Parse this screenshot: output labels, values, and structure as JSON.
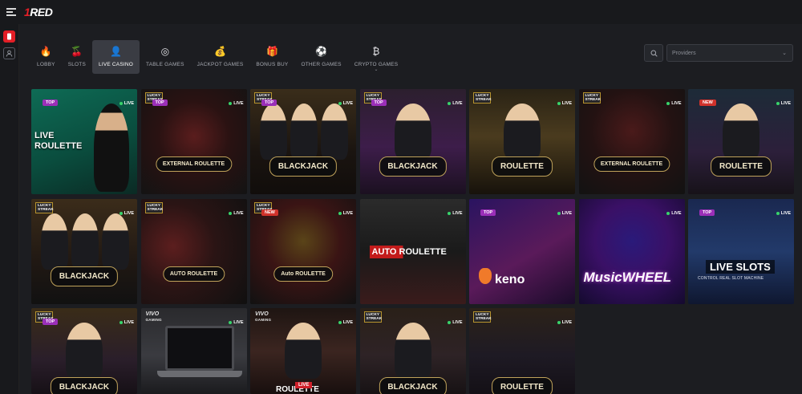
{
  "brand": {
    "logo_num": "1",
    "logo_word": "RED"
  },
  "nav": [
    {
      "label": "LOBBY",
      "icon": "flame-icon",
      "glyph": "🔥",
      "active": false
    },
    {
      "label": "SLOTS",
      "icon": "cherries-icon",
      "glyph": "🍒",
      "active": false
    },
    {
      "label": "LIVE CASINO",
      "icon": "dealer-icon",
      "glyph": "👤",
      "active": true
    },
    {
      "label": "TABLE GAMES",
      "icon": "chips-icon",
      "glyph": "◎",
      "active": false
    },
    {
      "label": "JACKPOT GAMES",
      "icon": "money-bag-icon",
      "glyph": "💰",
      "active": false
    },
    {
      "label": "BONUS BUY",
      "icon": "gift-icon",
      "glyph": "🎁",
      "active": false
    },
    {
      "label": "OTHER GAMES",
      "icon": "soccer-ball-icon",
      "glyph": "⚽",
      "active": false
    },
    {
      "label": "CRYPTO GAMES",
      "icon": "crypto-coins-icon",
      "glyph": "₿",
      "active": false
    }
  ],
  "providers": {
    "placeholder": "Providers"
  },
  "badges": {
    "top": "TOP",
    "new": "NEW",
    "live": "LIVE",
    "lucky_line1": "LUCKY",
    "lucky_line2": "STREAK",
    "vivo": "VIVO",
    "vivo_sub": "GAMING"
  },
  "tiles": [
    {
      "title": "LIVE ROULETTE",
      "badge": "TOP",
      "lucky": false,
      "vivo": false
    },
    {
      "title": "EXTERNAL ROULETTE",
      "badge": "TOP",
      "lucky": true,
      "vivo": false
    },
    {
      "title": "BLACKJACK",
      "badge": "TOP",
      "lucky": true,
      "vivo": false
    },
    {
      "title": "BLACKJACK",
      "badge": "TOP",
      "lucky": true,
      "vivo": false
    },
    {
      "title": "ROULETTE",
      "badge": "",
      "lucky": true,
      "vivo": false
    },
    {
      "title": "EXTERNAL ROULETTE",
      "badge": "",
      "lucky": true,
      "vivo": false
    },
    {
      "title": "ROULETTE",
      "badge": "NEW",
      "lucky": false,
      "vivo": false
    },
    {
      "title": "BLACKJACK",
      "badge": "",
      "lucky": true,
      "vivo": false
    },
    {
      "title": "AUTO ROULETTE",
      "badge": "",
      "lucky": true,
      "vivo": false
    },
    {
      "title": "Auto ROULETTE",
      "badge": "NEW",
      "lucky": true,
      "vivo": false
    },
    {
      "title": "AUTO ROULETTE",
      "badge": "",
      "lucky": false,
      "vivo": false
    },
    {
      "title": "keno",
      "badge": "TOP",
      "lucky": false,
      "vivo": false
    },
    {
      "title": "MusicWHEEL",
      "badge": "",
      "lucky": false,
      "vivo": false
    },
    {
      "title": "LIVE SLOTS",
      "subtitle": "CONTROL REAL SLOT MACHINE",
      "badge": "TOP",
      "lucky": false,
      "vivo": false
    },
    {
      "title": "BLACKJACK",
      "badge": "TOP",
      "lucky": true,
      "vivo": false
    },
    {
      "title": "",
      "badge": "",
      "lucky": false,
      "vivo": true
    },
    {
      "title": "ROULETTE",
      "badge": "",
      "lucky": false,
      "vivo": true,
      "live_tag": "LIVE"
    },
    {
      "title": "BLACKJACK",
      "badge": "",
      "lucky": true,
      "vivo": false
    },
    {
      "title": "ROULETTE",
      "badge": "",
      "lucky": true,
      "vivo": false
    }
  ]
}
